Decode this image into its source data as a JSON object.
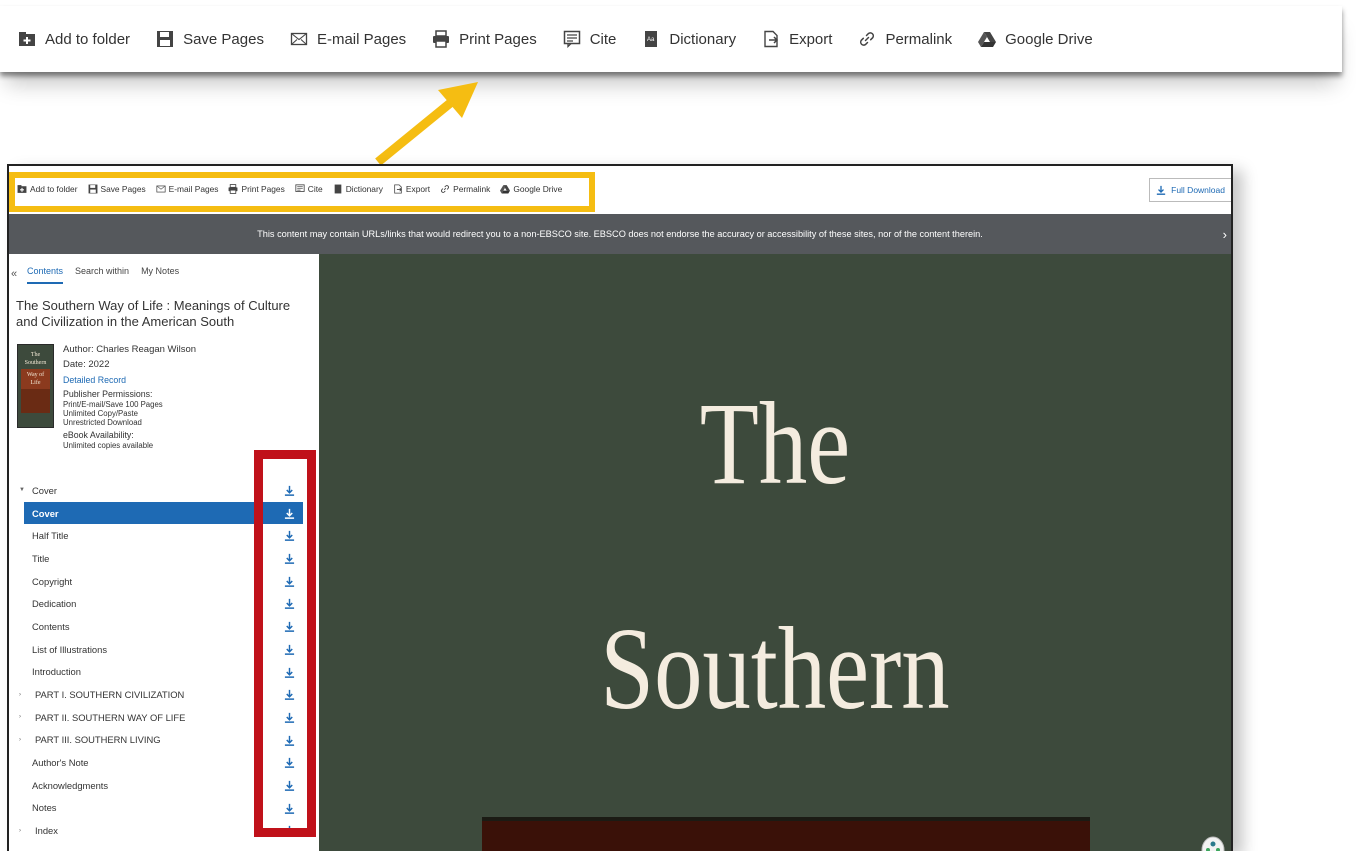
{
  "toolbar": {
    "items": [
      {
        "label": "Add to folder",
        "icon": "folder-add-icon"
      },
      {
        "label": "Save Pages",
        "icon": "save-icon"
      },
      {
        "label": "E-mail Pages",
        "icon": "email-icon"
      },
      {
        "label": "Print Pages",
        "icon": "print-icon"
      },
      {
        "label": "Cite",
        "icon": "cite-icon"
      },
      {
        "label": "Dictionary",
        "icon": "dictionary-icon"
      },
      {
        "label": "Export",
        "icon": "export-icon"
      },
      {
        "label": "Permalink",
        "icon": "link-icon"
      },
      {
        "label": "Google Drive",
        "icon": "google-drive-icon"
      }
    ],
    "full_download": "Full Download"
  },
  "banner": {
    "text": "This content may contain URLs/links that would redirect you to a non-EBSCO site. EBSCO does not endorse the accuracy or accessibility of these sites, nor of the content therein.",
    "close": "›"
  },
  "sidebar": {
    "collapse": "«",
    "tabs": [
      "Contents",
      "Search within",
      "My Notes"
    ],
    "book": {
      "title": "The Southern Way of Life : Meanings of Culture and Civilization in the American South",
      "author": "Author: Charles Reagan Wilson",
      "date": "Date: 2022",
      "detailed_record": "Detailed Record",
      "permissions_title": "Publisher Permissions:",
      "permissions": [
        "Print/E-mail/Save 100 Pages",
        "Unlimited Copy/Paste",
        "Unrestricted Download"
      ],
      "availability_title": "eBook Availability:",
      "availability": "Unlimited copies available",
      "thumb_text": [
        "The",
        "Southern",
        "Way of",
        "Life"
      ]
    },
    "toc": [
      {
        "label": "Cover",
        "expander": "▼",
        "indent": 1
      },
      {
        "label": "Cover",
        "selected": true
      },
      {
        "label": "Half Title"
      },
      {
        "label": "Title"
      },
      {
        "label": "Copyright"
      },
      {
        "label": "Dedication"
      },
      {
        "label": "Contents"
      },
      {
        "label": "List of Illustrations"
      },
      {
        "label": "Introduction"
      },
      {
        "label": "PART I. SOUTHERN CIVILIZATION",
        "expander": "›"
      },
      {
        "label": "PART II. SOUTHERN WAY OF LIFE",
        "expander": "›"
      },
      {
        "label": "PART III. SOUTHERN LIVING",
        "expander": "›"
      },
      {
        "label": "Author's Note"
      },
      {
        "label": "Acknowledgments"
      },
      {
        "label": "Notes"
      },
      {
        "label": "Index",
        "expander": "›"
      }
    ]
  },
  "viewer": {
    "line1": "The",
    "line2": "Southern"
  },
  "colors": {
    "accent": "#1e6ab4",
    "callout_highlight": "#f5bd12",
    "callout_red": "#c0111a",
    "cover_bg": "#3d4a3c",
    "banner_bg": "#55585c"
  }
}
